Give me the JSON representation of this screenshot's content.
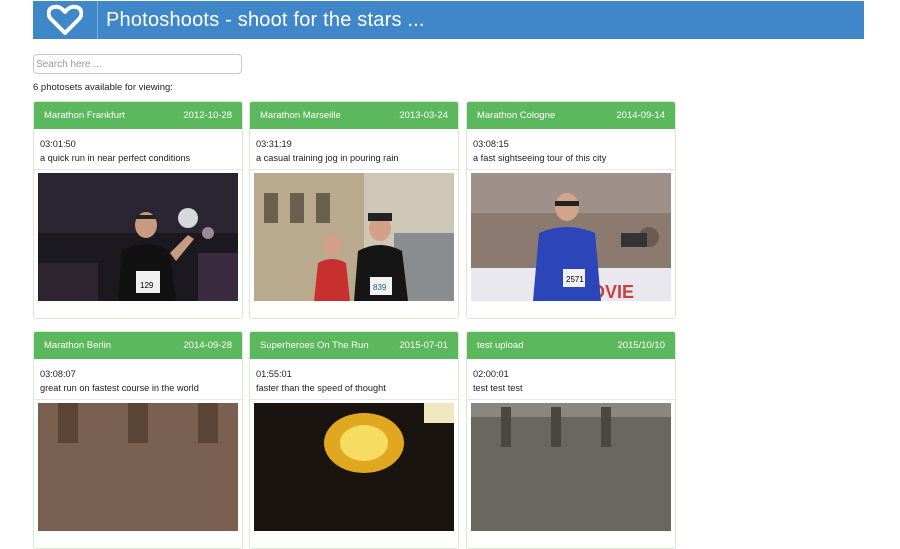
{
  "header": {
    "title": "Photoshoots - shoot for the stars ...",
    "logo_icon": "heart-icon"
  },
  "search": {
    "placeholder": "Search here ..."
  },
  "count_text": "6 photosets available for viewing:",
  "cards": [
    {
      "title": "Marathon Frankfurt",
      "date": "2012-10-28",
      "time": "03:01:50",
      "desc": "a quick run in near perfect conditions"
    },
    {
      "title": "Marathon Marseille",
      "date": "2013-03-24",
      "time": "03:31:19",
      "desc": "a casual training jog in pouring rain"
    },
    {
      "title": "Marathon Cologne",
      "date": "2014-09-14",
      "time": "03:08:15",
      "desc": "a fast sightseeing tour of this city"
    },
    {
      "title": "Marathon Berlin",
      "date": "2014-09-28",
      "time": "03:08:07",
      "desc": "great run on fastest course in the world"
    },
    {
      "title": "Superheroes On The Run",
      "date": "2015-07-01",
      "time": "01:55:01",
      "desc": "faster than the speed of thought"
    },
    {
      "title": "test upload",
      "date": "2015/10/10",
      "time": "02:00:01",
      "desc": "test test test"
    }
  ]
}
